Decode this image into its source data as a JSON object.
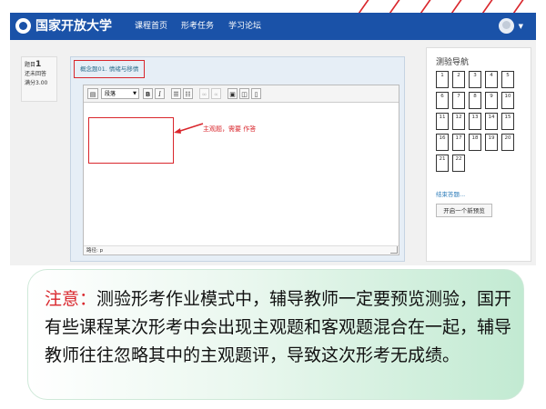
{
  "header": {
    "brand": "国家开放大学",
    "nav": [
      "课程首页",
      "形考任务",
      "学习论坛"
    ]
  },
  "question_info": {
    "label": "题目",
    "number": "1",
    "status": "还未回答",
    "score": "满分3.00"
  },
  "question": {
    "title": "概念题01. 情绪与移情",
    "format_select": "段落",
    "annotation": "主观题，需要 作答",
    "path": "路径: p"
  },
  "sidebar": {
    "title": "测验导航",
    "cells": [
      "1",
      "2",
      "3",
      "4",
      "5",
      "6",
      "7",
      "8",
      "9",
      "10",
      "11",
      "12",
      "13",
      "14",
      "15",
      "16",
      "17",
      "18",
      "19",
      "20",
      "21",
      "22"
    ],
    "finish_link": "结束答题...",
    "preview_button": "开启一个新预览"
  },
  "notice": {
    "label": "注意：",
    "text": "测验形考作业模式中，辅导教师一定要预览测验，国开有些课程某次形考中会出现主观题和客观题混合在一起，辅导教师往往忽略其中的主观题评，导致这次形考无成绩。"
  },
  "colors": {
    "header_bg": "#1a52a8",
    "highlight_red": "#d9262c",
    "link_blue": "#2a7ab8"
  }
}
